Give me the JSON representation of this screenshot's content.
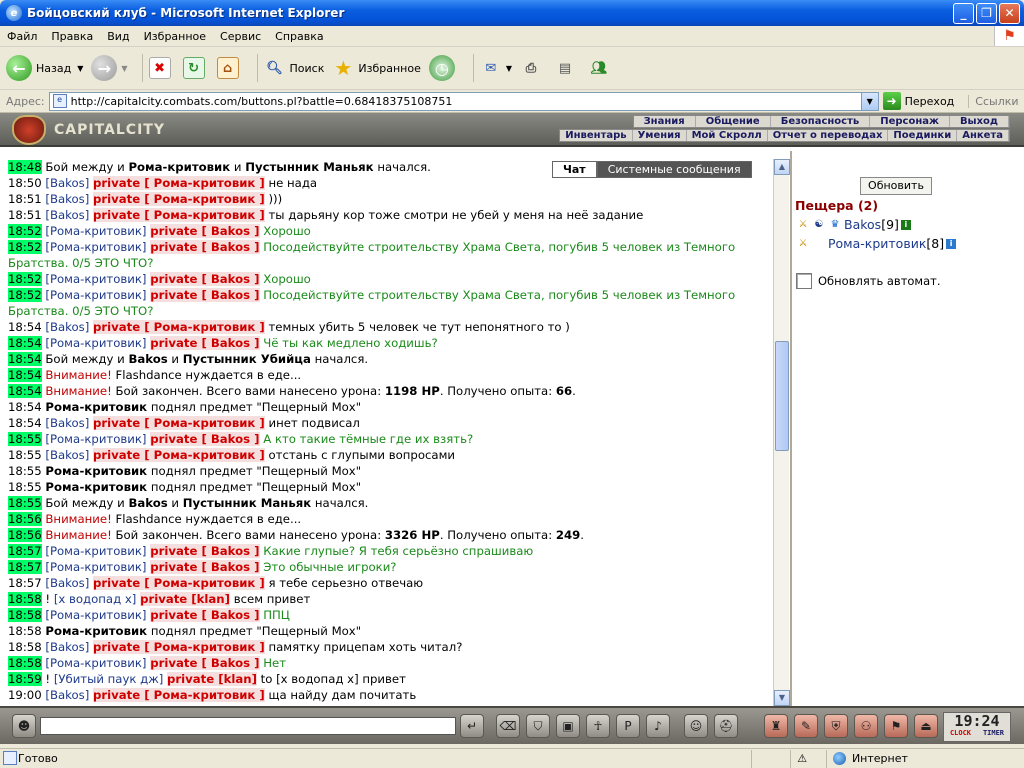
{
  "window": {
    "title": "Бойцовский клуб - Microsoft Internet Explorer"
  },
  "menu": [
    "Файл",
    "Правка",
    "Вид",
    "Избранное",
    "Сервис",
    "Справка"
  ],
  "toolbar": {
    "back": "Назад",
    "search": "Поиск",
    "favorites": "Избранное"
  },
  "address": {
    "label": "Адрес:",
    "url": "http://capitalcity.combats.com/buttons.pl?battle=0.68418375108751",
    "go": "Переход",
    "links": "Ссылки"
  },
  "game": {
    "logo": "CAPITALCITY",
    "nav_top": [
      "Знания",
      "Общение",
      "Безопасность",
      "Персонаж",
      "Выход"
    ],
    "nav_bottom": [
      "Инвентарь",
      "Умения",
      "Мой Скролл",
      "Отчет о переводах",
      "Поединки",
      "Анкета"
    ],
    "tabs": [
      "Чат",
      "Системные сообщения"
    ],
    "chat": [
      {
        "t": "18:48",
        "hl": true,
        "p": [
          [
            "",
            "Бой между и "
          ],
          [
            "bold",
            "Рома-критовик"
          ],
          [
            "",
            " и "
          ],
          [
            "bold",
            "Пустынник Маньяк"
          ],
          [
            "",
            " начался."
          ]
        ]
      },
      {
        "t": "18:50",
        "p": [
          [
            "u",
            "[Bakos]"
          ],
          [
            "",
            " "
          ],
          [
            "ub",
            "private [ Рома-критовик ]"
          ],
          [
            "",
            " не нада"
          ]
        ]
      },
      {
        "t": "18:51",
        "p": [
          [
            "u",
            "[Bakos]"
          ],
          [
            "",
            " "
          ],
          [
            "ub",
            "private [ Рома-критовик ]"
          ],
          [
            "",
            " )))"
          ]
        ]
      },
      {
        "t": "18:51",
        "p": [
          [
            "u",
            "[Bakos]"
          ],
          [
            "",
            " "
          ],
          [
            "ub",
            "private [ Рома-критовик ]"
          ],
          [
            "",
            " ты дарьяну кор тоже смотри не убей у меня на неё задание"
          ]
        ]
      },
      {
        "t": "18:52",
        "hl": true,
        "p": [
          [
            "u",
            "[Рома-критовик]"
          ],
          [
            "",
            " "
          ],
          [
            "ub",
            "private [ Bakos ]"
          ],
          [
            "grn",
            " Хорошо"
          ]
        ]
      },
      {
        "t": "18:52",
        "hl": true,
        "p": [
          [
            "u",
            "[Рома-критовик]"
          ],
          [
            "",
            " "
          ],
          [
            "ub",
            "private [ Bakos ]"
          ],
          [
            "grn",
            " Посодействуйте строительству Храма Света, погубив 5 человек из Темного Братства. 0/5 ЭТО ЧТО?"
          ]
        ]
      },
      {
        "t": "18:52",
        "hl": true,
        "p": [
          [
            "u",
            "[Рома-критовик]"
          ],
          [
            "",
            " "
          ],
          [
            "ub",
            "private [ Bakos ]"
          ],
          [
            "grn",
            " Хорошо"
          ]
        ]
      },
      {
        "t": "18:52",
        "hl": true,
        "p": [
          [
            "u",
            "[Рома-критовик]"
          ],
          [
            "",
            " "
          ],
          [
            "ub",
            "private [ Bakos ]"
          ],
          [
            "grn",
            " Посодействуйте строительству Храма Света, погубив 5 человек из Темного Братства. 0/5 ЭТО ЧТО?"
          ]
        ]
      },
      {
        "t": "18:54",
        "p": [
          [
            "u",
            "[Bakos]"
          ],
          [
            "",
            " "
          ],
          [
            "ub",
            "private [ Рома-критовик ]"
          ],
          [
            "",
            " темных убить 5 человек че тут непонятного то )"
          ]
        ]
      },
      {
        "t": "18:54",
        "hl": true,
        "p": [
          [
            "u",
            "[Рома-критовик]"
          ],
          [
            "",
            " "
          ],
          [
            "ub",
            "private [ Bakos ]"
          ],
          [
            "grn",
            " Чё ты как медлено ходишь?"
          ]
        ]
      },
      {
        "t": "18:54",
        "hl": true,
        "p": [
          [
            "",
            "Бой между и "
          ],
          [
            "bold",
            "Bakos"
          ],
          [
            "",
            " и "
          ],
          [
            "bold",
            "Пустынник Убийца"
          ],
          [
            "",
            " начался."
          ]
        ]
      },
      {
        "t": "18:54",
        "hl": true,
        "p": [
          [
            "warn",
            "Внимание!"
          ],
          [
            "",
            " Flashdance нуждается в еде..."
          ]
        ]
      },
      {
        "t": "18:54",
        "hl": true,
        "p": [
          [
            "warn",
            "Внимание!"
          ],
          [
            "",
            " Бой закончен. Всего вами нанесено урона: "
          ],
          [
            "bold",
            "1198 HP"
          ],
          [
            "",
            ". Получено опыта: "
          ],
          [
            "bold",
            "66"
          ],
          [
            "",
            "."
          ]
        ]
      },
      {
        "t": "18:54",
        "p": [
          [
            "bold",
            "Рома-критовик"
          ],
          [
            "",
            " поднял предмет \"Пещерный Мох\""
          ]
        ]
      },
      {
        "t": "18:54",
        "p": [
          [
            "u",
            "[Bakos]"
          ],
          [
            "",
            " "
          ],
          [
            "ub",
            "private [ Рома-критовик ]"
          ],
          [
            "",
            " инет подвисал"
          ]
        ]
      },
      {
        "t": "18:55",
        "hl": true,
        "p": [
          [
            "u",
            "[Рома-критовик]"
          ],
          [
            "",
            " "
          ],
          [
            "ub",
            "private [ Bakos ]"
          ],
          [
            "grn",
            " А кто такие тёмные где их взять?"
          ]
        ]
      },
      {
        "t": "18:55",
        "p": [
          [
            "u",
            "[Bakos]"
          ],
          [
            "",
            " "
          ],
          [
            "ub",
            "private [ Рома-критовик ]"
          ],
          [
            "",
            " отстань с глупыми вопросами"
          ]
        ]
      },
      {
        "t": "18:55",
        "p": [
          [
            "bold",
            "Рома-критовик"
          ],
          [
            "",
            " поднял предмет \"Пещерный Мох\""
          ]
        ]
      },
      {
        "t": "18:55",
        "p": [
          [
            "bold",
            "Рома-критовик"
          ],
          [
            "",
            " поднял предмет \"Пещерный Мох\""
          ]
        ]
      },
      {
        "t": "18:55",
        "hl": true,
        "p": [
          [
            "",
            "Бой между и "
          ],
          [
            "bold",
            "Bakos"
          ],
          [
            "",
            " и "
          ],
          [
            "bold",
            "Пустынник Маньяк"
          ],
          [
            "",
            " начался."
          ]
        ]
      },
      {
        "t": "18:56",
        "hl": true,
        "p": [
          [
            "warn",
            "Внимание!"
          ],
          [
            "",
            " Flashdance нуждается в еде..."
          ]
        ]
      },
      {
        "t": "18:56",
        "hl": true,
        "p": [
          [
            "warn",
            "Внимание!"
          ],
          [
            "",
            " Бой закончен. Всего вами нанесено урона: "
          ],
          [
            "bold",
            "3326 HP"
          ],
          [
            "",
            ". Получено опыта: "
          ],
          [
            "bold",
            "249"
          ],
          [
            "",
            "."
          ]
        ]
      },
      {
        "t": "18:57",
        "hl": true,
        "p": [
          [
            "u",
            "[Рома-критовик]"
          ],
          [
            "",
            " "
          ],
          [
            "ub",
            "private [ Bakos ]"
          ],
          [
            "grn",
            " Какие глупые? Я тебя серьёзно спрашиваю"
          ]
        ]
      },
      {
        "t": "18:57",
        "hl": true,
        "p": [
          [
            "u",
            "[Рома-критовик]"
          ],
          [
            "",
            " "
          ],
          [
            "ub",
            "private [ Bakos ]"
          ],
          [
            "grn",
            " Это обычные игроки?"
          ]
        ]
      },
      {
        "t": "18:57",
        "p": [
          [
            "u",
            "[Bakos]"
          ],
          [
            "",
            " "
          ],
          [
            "ub",
            "private [ Рома-критовик ]"
          ],
          [
            "",
            " я тебе серьезно отвечаю"
          ]
        ]
      },
      {
        "t": "18:58",
        "hl": true,
        "p": [
          [
            "",
            "! "
          ],
          [
            "u",
            "[x водопад x]"
          ],
          [
            "",
            " "
          ],
          [
            "ub",
            "private [klan]"
          ],
          [
            "",
            " всем привет"
          ]
        ]
      },
      {
        "t": "18:58",
        "hl": true,
        "p": [
          [
            "u",
            "[Рома-критовик]"
          ],
          [
            "",
            " "
          ],
          [
            "ub",
            "private [ Bakos ]"
          ],
          [
            "grn",
            " ППЦ"
          ]
        ]
      },
      {
        "t": "18:58",
        "p": [
          [
            "bold",
            "Рома-критовик"
          ],
          [
            "",
            " поднял предмет \"Пещерный Мох\""
          ]
        ]
      },
      {
        "t": "18:58",
        "p": [
          [
            "u",
            "[Bakos]"
          ],
          [
            "",
            " "
          ],
          [
            "ub",
            "private [ Рома-критовик ]"
          ],
          [
            "",
            " памятку прицепам хоть читал?"
          ]
        ]
      },
      {
        "t": "18:58",
        "hl": true,
        "p": [
          [
            "u",
            "[Рома-критовик]"
          ],
          [
            "",
            " "
          ],
          [
            "ub",
            "private [ Bakos ]"
          ],
          [
            "grn",
            " Нет"
          ]
        ]
      },
      {
        "t": "18:59",
        "hl": true,
        "p": [
          [
            "",
            "! "
          ],
          [
            "u",
            "[Убитый паук дж]"
          ],
          [
            "",
            " "
          ],
          [
            "ub",
            "private [klan]"
          ],
          [
            "",
            " to [x водопад x] привет"
          ]
        ]
      },
      {
        "t": "19:00",
        "p": [
          [
            "u",
            "[Bakos]"
          ],
          [
            "",
            " "
          ],
          [
            "ub",
            "private [ Рома-критовик ]"
          ],
          [
            "",
            " ща найду дам почитать"
          ]
        ]
      }
    ],
    "right": {
      "refresh": "Обновить",
      "location": "Пещера (2)",
      "players": [
        {
          "name": "Bakos",
          "level": "[9]"
        },
        {
          "name": "Рома-критовик",
          "level": "[8]"
        }
      ],
      "auto_refresh": "Обновлять автомат."
    },
    "clock": {
      "time": "19:24",
      "clock_label": "CLOCK",
      "timer_label": "TIMER"
    }
  },
  "statusbar": {
    "status": "Готово",
    "zone": "Интернет"
  },
  "colors": {
    "timestamp_highlight": "#00ff66",
    "private_tag": "#d00000",
    "private_bg": "#f4dede",
    "user": "#1e3a8a",
    "green_text": "#1a8a1a",
    "warning": "#c00000"
  }
}
